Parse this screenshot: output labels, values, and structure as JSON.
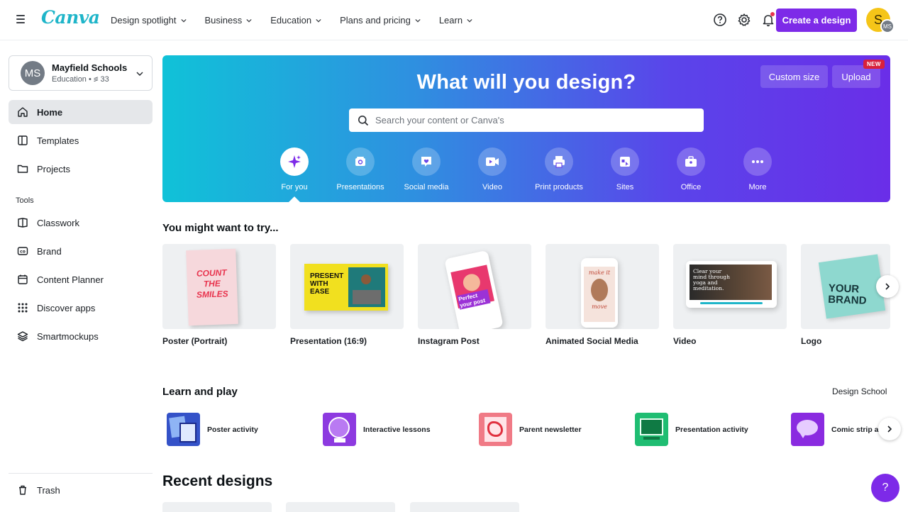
{
  "topbar": {
    "logo": "Canva",
    "nav": [
      "Design spotlight",
      "Business",
      "Education",
      "Plans and pricing",
      "Learn"
    ],
    "create_label": "Create a design",
    "avatar_initial": "S",
    "avatar_mini": "MS",
    "icons": [
      "help-circle-icon",
      "settings-gear-icon",
      "bell-icon"
    ]
  },
  "sidebar": {
    "team_initials": "MS",
    "team_name": "Mayfield Schools",
    "team_sub": "Education • ꠵ 33",
    "items": [
      {
        "label": "Home",
        "icon": "home-icon"
      },
      {
        "label": "Templates",
        "icon": "templates-icon"
      },
      {
        "label": "Projects",
        "icon": "folder-icon"
      }
    ],
    "tools_heading": "Tools",
    "tools": [
      {
        "label": "Classwork",
        "icon": "classwork-icon"
      },
      {
        "label": "Brand",
        "icon": "brand-icon"
      },
      {
        "label": "Content Planner",
        "icon": "calendar-icon"
      },
      {
        "label": "Discover apps",
        "icon": "apps-grid-icon"
      },
      {
        "label": "Smartmockups",
        "icon": "layers-icon"
      }
    ],
    "trash": "Trash"
  },
  "hero": {
    "title": "What will you design?",
    "custom_size": "Custom size",
    "upload": "Upload",
    "new_badge": "NEW",
    "search_placeholder": "Search your content or Canva's",
    "categories": [
      "For you",
      "Presentations",
      "Social media",
      "Video",
      "Print products",
      "Sites",
      "Office",
      "More"
    ]
  },
  "try": {
    "title": "You might want to try...",
    "cards": [
      "Poster (Portrait)",
      "Presentation (16:9)",
      "Instagram Post",
      "Animated Social Media",
      "Video",
      "Logo"
    ],
    "thumb_text": {
      "poster": "COUNT THE SMILES",
      "presentation": "PRESENT WITH EASE",
      "instagram": "Perfect your post",
      "animated_top": "make it",
      "animated_bottom": "move",
      "video": "Clear your mind through yoga and meditation.",
      "logo": "YOUR BRAND"
    }
  },
  "learn": {
    "title": "Learn and play",
    "design_school": "Design School",
    "items": [
      "Poster activity",
      "Interactive lessons",
      "Parent newsletter",
      "Presentation activity",
      "Comic strip ac"
    ]
  },
  "recent": {
    "title": "Recent designs"
  },
  "help_label": "?",
  "colors": {
    "accent": "#7d2ae8",
    "logo": "#1fb5c9",
    "badge": "#d8213b"
  }
}
